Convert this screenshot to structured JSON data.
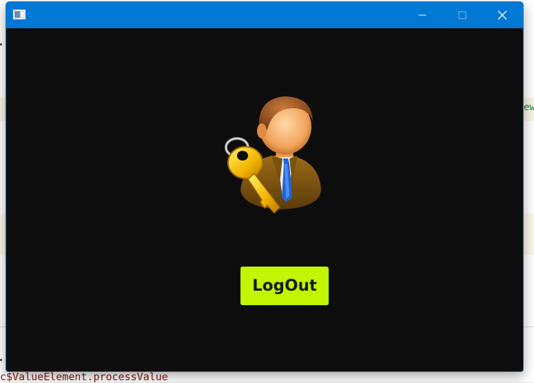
{
  "window": {
    "title": "",
    "controls": {
      "minimize": "minimize-icon",
      "maximize": "maximize-icon",
      "close": "close-icon"
    },
    "colors": {
      "titlebar": "#0078d4",
      "background": "#0d0d0d"
    }
  },
  "main": {
    "avatar_icon": "user-with-key-icon",
    "logout_label": "LogOut",
    "logout_color": "#c1f600"
  },
  "background_app": {
    "snippet_right": "ew",
    "snippet_bottom": "c$ValueElement.processValue"
  }
}
